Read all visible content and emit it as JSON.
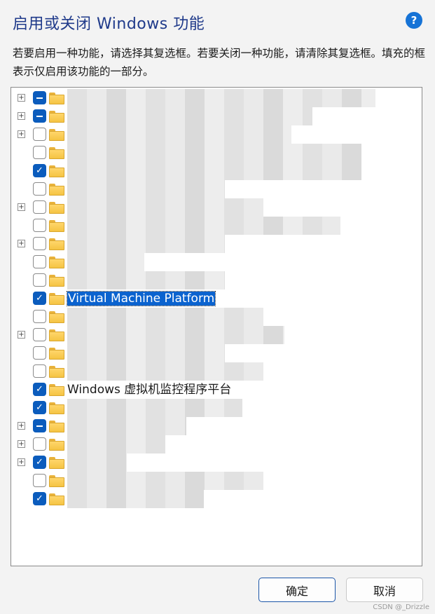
{
  "dialog": {
    "title": "启用或关闭 Windows 功能",
    "help_label": "?",
    "description": "若要启用一种功能，请选择其复选框。若要关闭一种功能，请清除其复选框。填充的框表示仅启用该功能的一部分。"
  },
  "features": [
    {
      "expander": true,
      "state": "partial",
      "label": "",
      "blur": 440
    },
    {
      "expander": true,
      "state": "partial",
      "label": "",
      "blur": 350
    },
    {
      "expander": true,
      "state": "unchecked",
      "label": "",
      "blur": 320
    },
    {
      "expander": false,
      "state": "unchecked",
      "label": "",
      "blur": 420
    },
    {
      "expander": false,
      "state": "checked",
      "label": "",
      "blur": 420
    },
    {
      "expander": false,
      "state": "unchecked",
      "label": "",
      "blur": 225
    },
    {
      "expander": true,
      "state": "unchecked",
      "label": "",
      "blur": 280
    },
    {
      "expander": false,
      "state": "unchecked",
      "label": "",
      "blur": 390
    },
    {
      "expander": true,
      "state": "unchecked",
      "label": "",
      "blur": 225
    },
    {
      "expander": false,
      "state": "unchecked",
      "label": "",
      "blur": 110
    },
    {
      "expander": false,
      "state": "unchecked",
      "label": "",
      "blur": 225
    },
    {
      "expander": false,
      "state": "checked",
      "label": "Virtual Machine Platform",
      "selected": true,
      "blur": 0
    },
    {
      "expander": false,
      "state": "unchecked",
      "label": "",
      "blur": 280
    },
    {
      "expander": true,
      "state": "unchecked",
      "label": "",
      "blur": 310
    },
    {
      "expander": false,
      "state": "unchecked",
      "label": "",
      "blur": 225
    },
    {
      "expander": false,
      "state": "unchecked",
      "label": "",
      "blur": 280
    },
    {
      "expander": false,
      "state": "checked",
      "label": "Windows 虚拟机监控程序平台",
      "blur": 0
    },
    {
      "expander": false,
      "state": "checked",
      "label": "",
      "blur": 250
    },
    {
      "expander": true,
      "state": "partial",
      "label": "",
      "blur": 170
    },
    {
      "expander": true,
      "state": "unchecked",
      "label": "",
      "blur": 140
    },
    {
      "expander": true,
      "state": "checked",
      "label": "",
      "blur": 85
    },
    {
      "expander": false,
      "state": "unchecked",
      "label": "",
      "blur": 280
    },
    {
      "expander": false,
      "state": "checked",
      "label": "",
      "blur": 195
    }
  ],
  "buttons": {
    "ok": "确定",
    "cancel": "取消"
  },
  "watermark": "CSDN @_Drizzle"
}
